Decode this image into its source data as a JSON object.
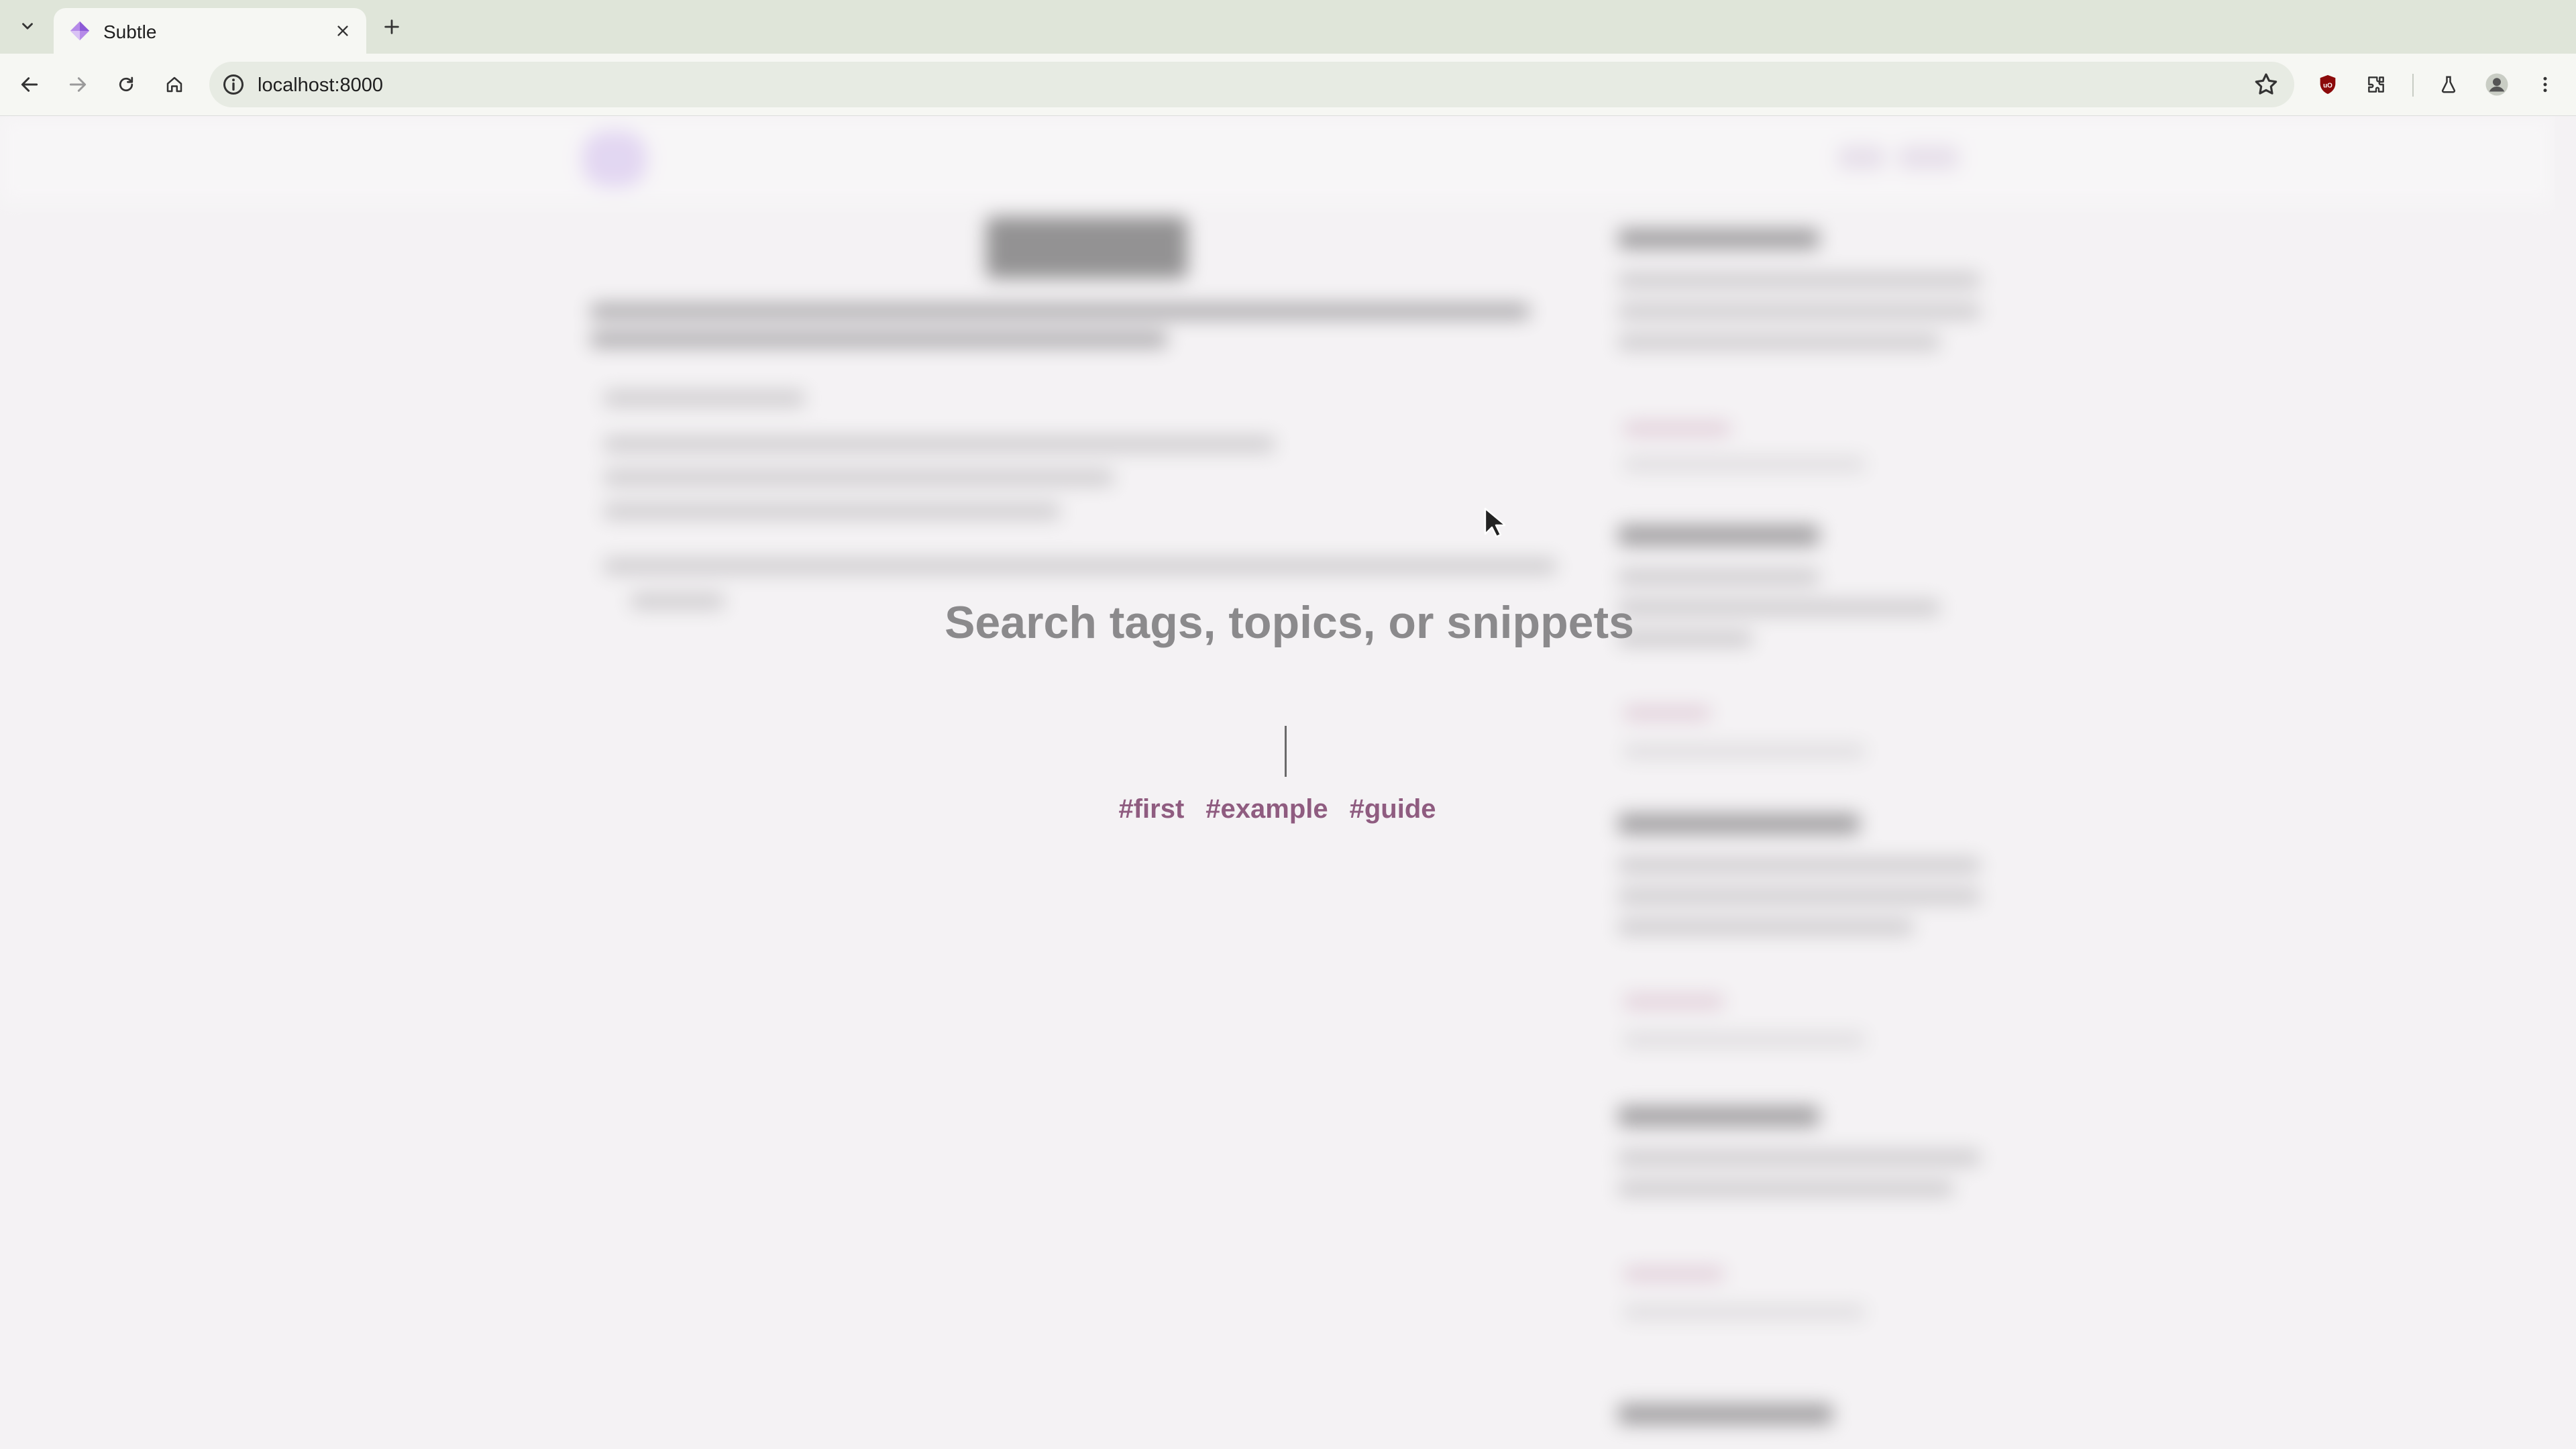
{
  "browser": {
    "tab_title": "Subtle",
    "url": "localhost:8000"
  },
  "search": {
    "placeholder": "Search tags, topics, or snippets",
    "tags": [
      "#first",
      "#example",
      "#guide"
    ]
  },
  "colors": {
    "tag_color": "#8f5c80",
    "placeholder_color": "#8b8a8c",
    "page_background": "#f4f2f4",
    "brand_accent": "#a46ee6"
  },
  "icons": {
    "tab_favicon": "subtle-diamond-icon",
    "tab_list": "chevron-down-icon",
    "tab_close": "close-icon",
    "new_tab": "plus-icon",
    "back": "back-arrow-icon",
    "forward": "forward-arrow-icon",
    "reload": "reload-icon",
    "home": "home-icon",
    "site_info": "info-icon",
    "bookmark": "star-icon",
    "ublock": "shield-icon",
    "extensions": "puzzle-icon",
    "labs": "flask-icon",
    "profile": "avatar-icon",
    "menu": "kebab-menu-icon"
  }
}
